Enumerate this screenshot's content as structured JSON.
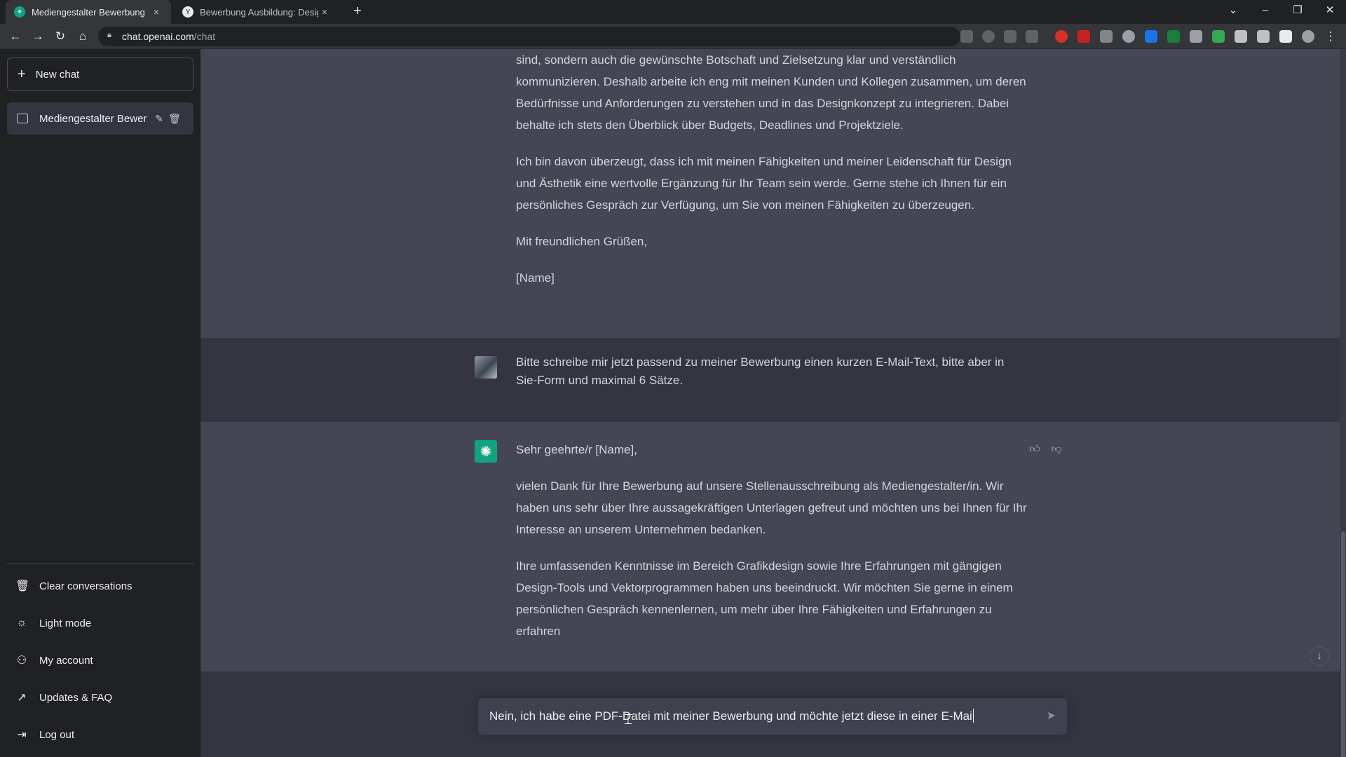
{
  "browser": {
    "tabs": [
      {
        "label": "Mediengestalter Bewerbung",
        "active": true,
        "close": "×"
      },
      {
        "label": "Bewerbung Ausbildung: Design-",
        "active": false,
        "close": "×"
      }
    ],
    "new_tab": "+",
    "url_host": "chat.openai.com",
    "url_path": "/chat"
  },
  "sidebar": {
    "new_chat_label": "New chat",
    "conversations": [
      {
        "label": "Mediengestalter Bewer"
      }
    ],
    "menu": [
      {
        "label": "Clear conversations",
        "icon": "trash-icon"
      },
      {
        "label": "Light mode",
        "icon": "sun-icon"
      },
      {
        "label": "My account",
        "icon": "user-icon"
      },
      {
        "label": "Updates & FAQ",
        "icon": "external-link-icon"
      },
      {
        "label": "Log out",
        "icon": "logout-icon"
      }
    ]
  },
  "messages": [
    {
      "role": "assistant",
      "paragraphs": [
        "sind, sondern auch die gewünschte Botschaft und Zielsetzung klar und verständlich kommunizieren. Deshalb arbeite ich eng mit meinen Kunden und Kollegen zusammen, um deren Bedürfnisse und Anforderungen zu verstehen und in das Designkonzept zu integrieren. Dabei behalte ich stets den Überblick über Budgets, Deadlines und Projektziele.",
        "Ich bin davon überzeugt, dass ich mit meinen Fähigkeiten und meiner Leidenschaft für Design und Ästhetik eine wertvolle Ergänzung für Ihr Team sein werde. Gerne stehe ich Ihnen für ein persönliches Gespräch zur Verfügung, um Sie von meinen Fähigkeiten zu überzeugen.",
        "Mit freundlichen Grüßen,",
        "[Name]"
      ]
    },
    {
      "role": "user",
      "paragraphs": [
        "Bitte schreibe mir jetzt passend zu meiner Bewerbung einen kurzen E-Mail-Text, bitte aber in Sie-Form und maximal 6 Sätze."
      ]
    },
    {
      "role": "assistant",
      "paragraphs": [
        "Sehr geehrte/r [Name],",
        "vielen Dank für Ihre Bewerbung auf unsere Stellenausschreibung als Mediengestalter/in. Wir haben uns sehr über Ihre aussagekräftigen Unterlagen gefreut und möchten uns bei Ihnen für Ihr Interesse an unserem Unternehmen bedanken.",
        "Ihre umfassenden Kenntnisse im Bereich Grafikdesign sowie Ihre Erfahrungen mit gängigen Design-Tools und Vektorprogrammen haben uns beeindruckt. Wir möchten Sie gerne in einem persönlichen Gespräch kennenlernen, um mehr über Ihre Fähigkeiten und Erfahrungen zu erfahren"
      ]
    }
  ],
  "composer": {
    "value": "Nein, ich habe eine PDF-Datei mit meiner Bewerbung und möchte jetzt diese in einer E-Mai"
  },
  "colors": {
    "sidebar_bg": "#202123",
    "main_bg": "#343541",
    "assistant_bg": "#444654",
    "brand_green": "#10a37f"
  }
}
